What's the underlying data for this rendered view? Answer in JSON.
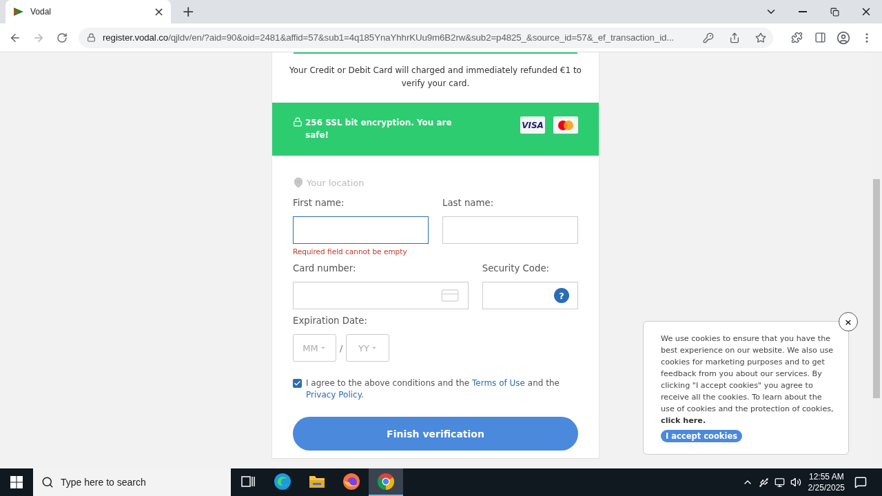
{
  "browser": {
    "tab": {
      "title": "Vodal",
      "close": "×"
    },
    "new_tab": "+",
    "url": {
      "domain": "register.vodal.co",
      "path": "/qjldv/en/?aid=90&oid=2481&affid=57&sub1=4q185YnaYhhrKUu9m6B2rw&sub2=p4825_&source_id=57&_ef_transaction_id..."
    }
  },
  "notice": "Your Credit or Debit Card will charged and immediately refunded €1 to verify your card.",
  "security_banner": {
    "text": "256 SSL bit encryption. You are safe!",
    "card_brands": [
      {
        "kind": "visa",
        "label": "VISA"
      },
      {
        "kind": "mastercard"
      }
    ]
  },
  "location": {
    "placeholder": "Your location"
  },
  "fields": [
    {
      "kind": "text",
      "label": "First name:",
      "focused": true,
      "error": "Required field cannot be empty"
    },
    {
      "kind": "text",
      "label": "Last name:",
      "focused": false
    },
    {
      "kind": "card",
      "label": "Card number:",
      "focused": false
    },
    {
      "kind": "cvc",
      "label": "Security Code:",
      "focused": false,
      "help": "?"
    }
  ],
  "expiration": {
    "label": "Expiration Date:",
    "month": "MM",
    "separator": "/",
    "year": "YY"
  },
  "agreement": {
    "checked": true,
    "before": "I agree to the above conditions and the",
    "terms_link": "Terms of Use",
    "middle": "and the",
    "privacy_link": "Privacy Policy",
    "after": "."
  },
  "submit": "Finish verification",
  "cookie_notice": {
    "close": "×",
    "text": "We use cookies to ensure that you have the best experience on our website. We also use cookies for marketing purposes and to get feedback from you about our services. By clicking \"I accept cookies\" you agree to receive all the cookies. To learn about the use of cookies and the protection of cookies,",
    "link": "click here.",
    "accept": "I accept cookies"
  },
  "taskbar": {
    "search_placeholder": "Type here to search",
    "apps": [
      {
        "kind": "taskview",
        "selected": false
      },
      {
        "kind": "edge",
        "selected": false
      },
      {
        "kind": "explorer",
        "selected": false
      },
      {
        "kind": "firefox",
        "selected": false
      },
      {
        "kind": "chrome",
        "selected": true
      }
    ],
    "time": "12:55 AM",
    "date": "2/25/2025"
  }
}
